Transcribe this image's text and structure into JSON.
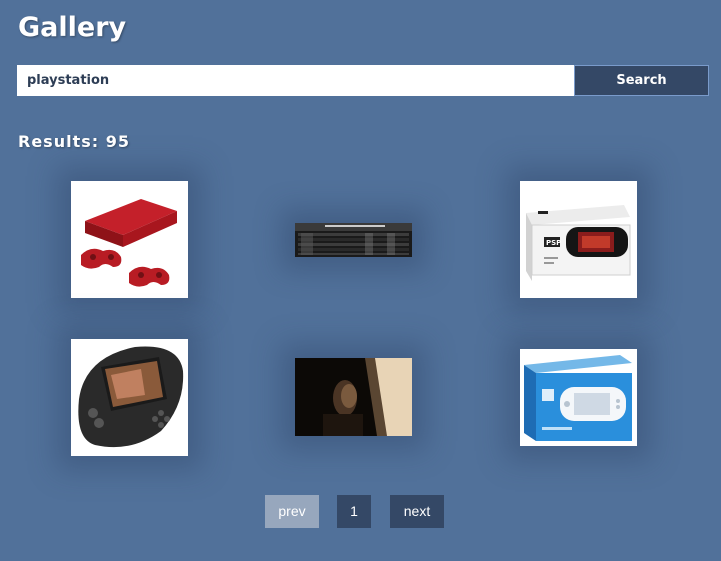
{
  "header": {
    "title": "Gallery"
  },
  "search": {
    "value": "playstation",
    "button_label": "Search"
  },
  "results": {
    "label": "Results: 95"
  },
  "gallery": {
    "items": [
      {
        "icon": "red-ps3-console-with-controllers"
      },
      {
        "icon": "dark-scoreboard-screenshot"
      },
      {
        "icon": "psp-retail-box"
      },
      {
        "icon": "black-psp-handheld"
      },
      {
        "icon": "dark-movie-still"
      },
      {
        "icon": "white-psp-retail-box"
      }
    ]
  },
  "pagination": {
    "prev_label": "prev",
    "page_label": "1",
    "next_label": "next"
  },
  "colors": {
    "background": "#51719a",
    "button_dark": "#344866",
    "button_disabled": "#97a7bd"
  }
}
